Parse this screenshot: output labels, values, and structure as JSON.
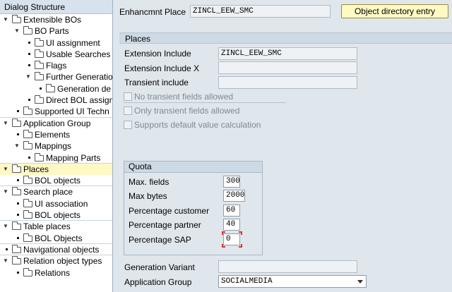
{
  "tree": {
    "title": "Dialog Structure",
    "nodes": [
      {
        "label": "Extensible BOs",
        "level": 0,
        "twisty": "open",
        "icon": "folder"
      },
      {
        "label": "BO Parts",
        "level": 1,
        "twisty": "open",
        "icon": "folder"
      },
      {
        "label": "UI assignment",
        "level": 2,
        "icon": "folder"
      },
      {
        "label": "Usable Searches",
        "level": 2,
        "icon": "folder"
      },
      {
        "label": "Flags",
        "level": 2,
        "icon": "folder"
      },
      {
        "label": "Further Generation",
        "level": 2,
        "twisty": "open",
        "icon": "folder"
      },
      {
        "label": "Generation de",
        "level": 3,
        "icon": "folder"
      },
      {
        "label": "Direct BOL assign",
        "level": 2,
        "icon": "folder"
      },
      {
        "label": "Supported UI Techn",
        "level": 1,
        "icon": "folder"
      },
      {
        "label": "Application Group",
        "level": 0,
        "twisty": "open",
        "icon": "folder"
      },
      {
        "label": "Elements",
        "level": 1,
        "icon": "folder"
      },
      {
        "label": "Mappings",
        "level": 1,
        "twisty": "open",
        "icon": "folder"
      },
      {
        "label": "Mapping Parts",
        "level": 2,
        "icon": "folder"
      },
      {
        "label": "Places",
        "level": 0,
        "twisty": "open",
        "icon": "folder-open",
        "selected": true
      },
      {
        "label": "BOL objects",
        "level": 1,
        "icon": "folder"
      },
      {
        "label": "Search place",
        "level": 0,
        "twisty": "open",
        "icon": "folder"
      },
      {
        "label": "UI association",
        "level": 1,
        "icon": "folder"
      },
      {
        "label": "BOL objects",
        "level": 1,
        "icon": "folder"
      },
      {
        "label": "Table places",
        "level": 0,
        "twisty": "open",
        "icon": "folder"
      },
      {
        "label": "BOL Objects",
        "level": 1,
        "icon": "folder"
      },
      {
        "label": "Navigational objects",
        "level": 0,
        "icon": "folder"
      },
      {
        "label": "Relation object types",
        "level": 0,
        "twisty": "open",
        "icon": "folder"
      },
      {
        "label": "Relations",
        "level": 1,
        "icon": "folder"
      }
    ]
  },
  "header": {
    "enh_label": "Enhancmnt Place",
    "enh_value": "ZINCL_EEW_SMC",
    "button_label": "Object directory entry"
  },
  "places": {
    "title": "Places",
    "fields": [
      {
        "label": "Extension Include",
        "value": "ZINCL_EEW_SMC"
      },
      {
        "label": "Extension Include X",
        "value": ""
      },
      {
        "label": "Transient include",
        "value": ""
      }
    ],
    "checkboxes": [
      {
        "label": "No transient fields allowed",
        "checked": false
      },
      {
        "label": "Only transient fields allowed",
        "checked": false
      },
      {
        "label": "Supports default value calculation",
        "checked": false
      }
    ]
  },
  "quota": {
    "title": "Quota",
    "rows": [
      {
        "label": "Max. fields",
        "value": "300"
      },
      {
        "label": "Max bytes",
        "value": "2000"
      },
      {
        "label": "Percentage customer",
        "value": "60"
      },
      {
        "label": "Percentage partner",
        "value": "40"
      },
      {
        "label": "Percentage SAP",
        "value": "0"
      }
    ]
  },
  "bottom": {
    "gen_label": "Generation Variant",
    "gen_value": "",
    "app_label": "Application Group",
    "app_value": "SOCIALMEDIA"
  }
}
